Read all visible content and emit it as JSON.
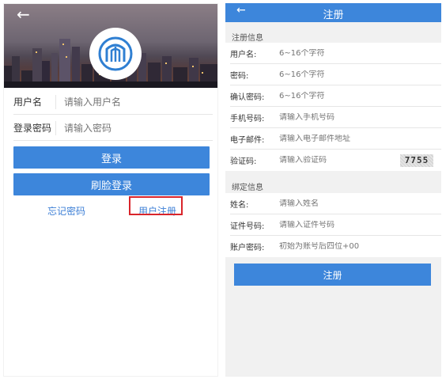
{
  "login": {
    "back_icon": "arrow-left-icon",
    "logo_icon": "arch-logo-icon",
    "username_label": "用户名",
    "username_placeholder": "请输入用户名",
    "password_label": "登录密码",
    "password_placeholder": "请输入密码",
    "login_button": "登录",
    "face_login_button": "刷脸登录",
    "forgot_password_link": "忘记密码",
    "register_link": "用户注册",
    "highlight_color": "#d9252b",
    "accent_color": "#3d86db"
  },
  "register": {
    "back_icon": "arrow-left-icon",
    "title": "注册",
    "section_info": "注册信息",
    "fields": [
      {
        "label": "用户名:",
        "placeholder": "6~16个字符"
      },
      {
        "label": "密码:",
        "placeholder": "6~16个字符"
      },
      {
        "label": "确认密码:",
        "placeholder": "6~16个字符"
      },
      {
        "label": "手机号码:",
        "placeholder": "请输入手机号码"
      },
      {
        "label": "电子邮件:",
        "placeholder": "请输入电子邮件地址"
      },
      {
        "label": "验证码:",
        "placeholder": "请输入验证码"
      }
    ],
    "captcha_text": "7755",
    "section_bind": "绑定信息",
    "bind_fields": [
      {
        "label": "姓名:",
        "placeholder": "请输入姓名"
      },
      {
        "label": "证件号码:",
        "placeholder": "请输入证件号码"
      },
      {
        "label": "账户密码:",
        "placeholder": "初始为账号后四位+00"
      }
    ],
    "submit_button": "注册"
  }
}
